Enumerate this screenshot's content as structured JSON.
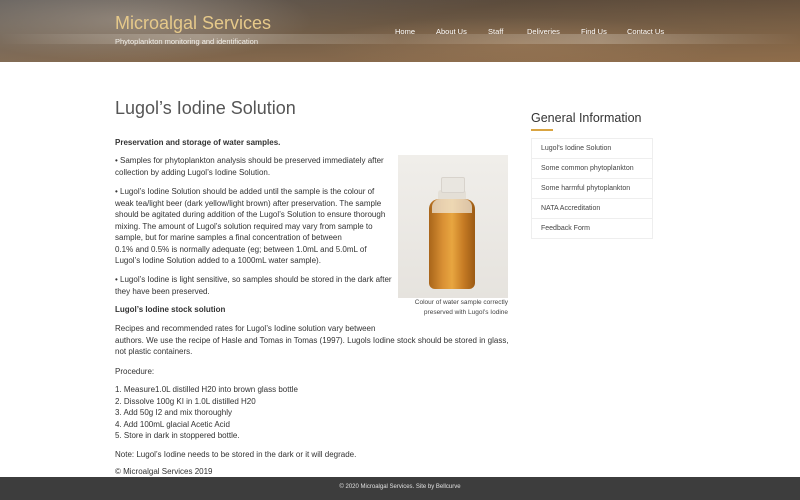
{
  "header": {
    "site_title": "Microalgal Services",
    "tagline": "Phytoplankton monitoring and identification",
    "nav": [
      "Home",
      "About Us",
      "Staff",
      "Deliveries",
      "Find Us",
      "Contact Us"
    ]
  },
  "page": {
    "title": "Lugol’s Iodine Solution",
    "heading_storage": "Preservation and storage of water samples.",
    "para1_l1": "• Samples for phytoplankton analysis should be preserved immediately after",
    "para1_l2": "collection by adding Lugol’s Iodine Solution.",
    "para2_lines": [
      "•  Lugol’s Iodine Solution should be added until the sample is the colour of",
      "weak tea/light beer (dark yellow/light brown) after preservation. The sample",
      "should be agitated during addition of the Lugol’s Solution to ensure thorough",
      "mixing.  The amount of Lugol’s solution required may vary from sample to",
      "sample, but for marine samples a final concentration of between",
      "0.1% and 0.5% is normally adequate (eg; between 1.0mL and 5.0mL of",
      "Lugol’s Iodine Solution added to a  1000mL water sample)."
    ],
    "para3_l1": "• Lugol’s Iodine is light sensitive, so samples should be stored in the dark after",
    "para3_l2": "they have been preserved.",
    "heading_stock": "Lugol’s Iodine stock solution",
    "para4_l1": "Recipes and recommended rates for Lugol’s Iodine solution vary between",
    "para4_l2": "authors. We use the recipe of Hasle and Tomas in Tomas (1997). Lugols Iodine stock should be stored in glass,",
    "para4_l3": "not plastic containers.",
    "procedure_label": "Procedure:",
    "steps": [
      "1. Measure1.0L distilled H20 into brown glass bottle",
      "2. Dissolve 100g KI in 1.0L distilled H20",
      "3. Add 50g I2 and mix thoroughly",
      "4. Add 100mL glacial Acetic Acid",
      "5. Store in dark in stoppered bottle."
    ],
    "note": "Note: Lugol’s Iodine needs to be stored in the dark or it will degrade.",
    "copyright": "© Microalgal Services 2019",
    "caption_l1": "Colour of water sample correctly",
    "caption_l2": "preserved with Lugol’s Iodine"
  },
  "sidebar": {
    "title": "General Information",
    "items": [
      "Lugol’s Iodine Solution",
      "Some common phytoplankton",
      "Some harmful phytoplankton",
      "NATA Accreditation",
      "Feedback Form"
    ]
  },
  "footer": {
    "text": "© 2020 Microalgal Services. Site by Bellcurve"
  },
  "colors": {
    "accent": "#d9a441",
    "site_title": "#e6c98a",
    "footer_bg": "#3d3d3d"
  }
}
